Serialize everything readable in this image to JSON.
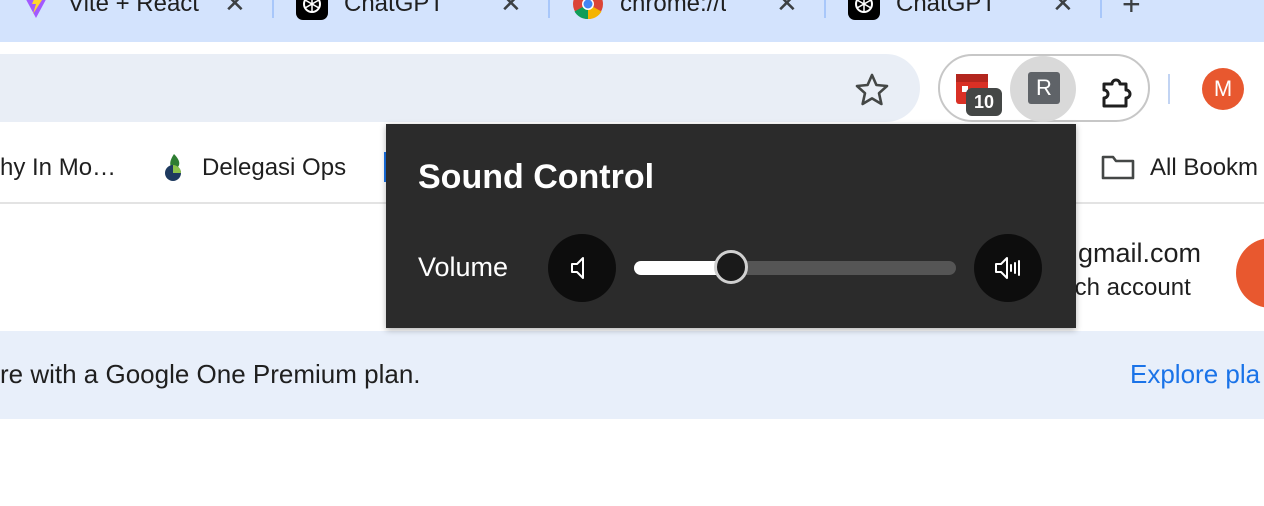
{
  "tabs": [
    {
      "title": "Vite + React",
      "icon": "vite-icon"
    },
    {
      "title": "ChatGPT",
      "icon": "chatgpt-icon"
    },
    {
      "title": "chrome://tabs",
      "icon": "chrome-icon"
    },
    {
      "title": "ChatGPT",
      "icon": "chatgpt-icon"
    }
  ],
  "tab_close_glyph": "✕",
  "new_tab_glyph": "+",
  "toolbar": {
    "star_icon": "bookmark-star-icon",
    "extensions": {
      "calendar_badge": "10",
      "r_extension_label": "R",
      "puzzle_icon": "extensions-puzzle-icon"
    },
    "profile_initial": "M"
  },
  "bookmarks": {
    "item1": "hy In Mo…",
    "item2": "Delegasi Ops",
    "all_bookmarks": "All Bookm"
  },
  "page": {
    "account_email": "gmail.com",
    "account_switch": "tch account",
    "banner_text": "re with a Google One Premium plan.",
    "banner_link": "Explore pla"
  },
  "sound_control": {
    "title": "Sound Control",
    "volume_label": "Volume",
    "volume_level": 0.3,
    "mute_icon": "volume-low-icon",
    "max_icon": "volume-high-icon"
  },
  "colors": {
    "tabstrip": "#d3e3fd",
    "popup_bg": "#2b2b2b",
    "accent_blue": "#1a73e8",
    "avatar_orange": "#e8582f"
  }
}
